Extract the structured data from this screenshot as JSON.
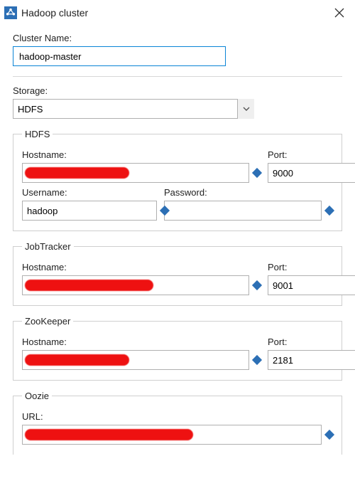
{
  "window": {
    "title": "Hadoop cluster"
  },
  "cluster": {
    "name_label": "Cluster Name:",
    "name_value": "hadoop-master"
  },
  "storage": {
    "label": "Storage:",
    "selected": "HDFS"
  },
  "hdfs": {
    "legend": "HDFS",
    "hostname_label": "Hostname:",
    "hostname_value": "",
    "port_label": "Port:",
    "port_value": "9000",
    "username_label": "Username:",
    "username_value": "hadoop",
    "password_label": "Password:",
    "password_value": ""
  },
  "jobtracker": {
    "legend": "JobTracker",
    "hostname_label": "Hostname:",
    "hostname_value": "",
    "port_label": "Port:",
    "port_value": "9001"
  },
  "zookeeper": {
    "legend": "ZooKeeper",
    "hostname_label": "Hostname:",
    "hostname_value": "",
    "port_label": "Port:",
    "port_value": "2181"
  },
  "oozie": {
    "legend": "Oozie",
    "url_label": "URL:",
    "url_value": ""
  }
}
